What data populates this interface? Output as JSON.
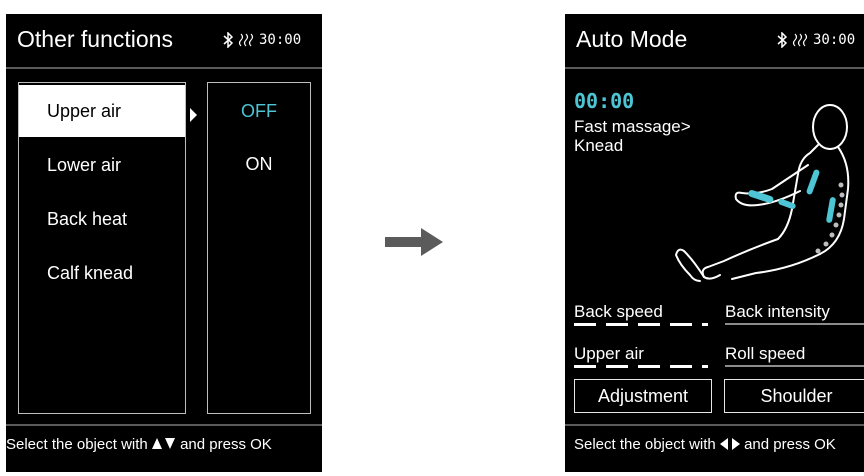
{
  "left_screen": {
    "title": "Other functions",
    "status": {
      "bluetooth_icon": "bluetooth-icon",
      "heat_icon": "heat-waves-icon",
      "time": "30:00"
    },
    "menu": {
      "items": [
        {
          "label": "Upper air",
          "selected": true
        },
        {
          "label": "Lower air",
          "selected": false
        },
        {
          "label": "Back heat",
          "selected": false
        },
        {
          "label": "Calf knead",
          "selected": false
        }
      ]
    },
    "options": [
      {
        "label": "OFF",
        "active": true
      },
      {
        "label": "ON",
        "active": false
      }
    ],
    "footer": {
      "prefix": "Select the object with",
      "icon": "up-down-arrows-icon",
      "suffix": "and press OK"
    }
  },
  "right_screen": {
    "title": "Auto Mode",
    "status": {
      "bluetooth_icon": "bluetooth-icon",
      "heat_icon": "heat-waves-icon",
      "time": "30:00"
    },
    "timer": "00:00",
    "program_line1": "Fast massage>",
    "program_line2": "Knead",
    "params": {
      "back_speed": "Back speed",
      "back_intensity": "Back intensity",
      "upper_air": "Upper air",
      "roll_speed": "Roll speed"
    },
    "buttons": {
      "adjustment": "Adjustment",
      "shoulder": "Shoulder"
    },
    "footer": {
      "prefix": "Select the object with",
      "icon": "left-right-arrows-icon",
      "suffix": "and press OK"
    }
  },
  "transition_arrow_icon": "right-arrow-icon",
  "colors": {
    "accent": "#4ec5d4",
    "screen_bg": "#000000",
    "divider": "#5a5a5a"
  }
}
